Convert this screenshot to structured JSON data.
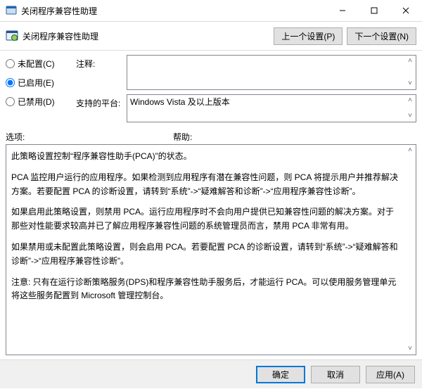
{
  "window": {
    "title": "关闭程序兼容性助理"
  },
  "header": {
    "label": "关闭程序兼容性助理",
    "prev_btn": "上一个设置(P)",
    "next_btn": "下一个设置(N)"
  },
  "radios": {
    "not_configured": "未配置(C)",
    "enabled": "已启用(E)",
    "disabled": "已禁用(D)",
    "selected": "enabled"
  },
  "form": {
    "comment_label": "注释:",
    "comment_value": "",
    "platform_label": "支持的平台:",
    "platform_value": "Windows Vista 及以上版本"
  },
  "mid": {
    "options_label": "选项:",
    "help_label": "帮助:"
  },
  "help": {
    "p1": "此策略设置控制“程序兼容性助手(PCA)”的状态。",
    "p2": "PCA 监控用户运行的应用程序。如果检测到应用程序有潜在兼容性问题，则 PCA 将提示用户并推荐解决方案。若要配置 PCA 的诊断设置，请转到“系统”->“疑难解答和诊断”->“应用程序兼容性诊断”。",
    "p3": "如果启用此策略设置，则禁用 PCA。运行应用程序时不会向用户提供已知兼容性问题的解决方案。对于那些对性能要求较高并已了解应用程序兼容性问题的系统管理员而言，禁用 PCA 非常有用。",
    "p4": "如果禁用或未配置此策略设置，则会启用 PCA。若要配置 PCA 的诊断设置，请转到“系统”->“疑难解答和诊断”->“应用程序兼容性诊断”。",
    "p5": "注意: 只有在运行诊断策略服务(DPS)和程序兼容性助手服务后，才能运行 PCA。可以使用服务管理单元将这些服务配置到 Microsoft 管理控制台。"
  },
  "footer": {
    "ok": "确定",
    "cancel": "取消",
    "apply": "应用(A)"
  }
}
